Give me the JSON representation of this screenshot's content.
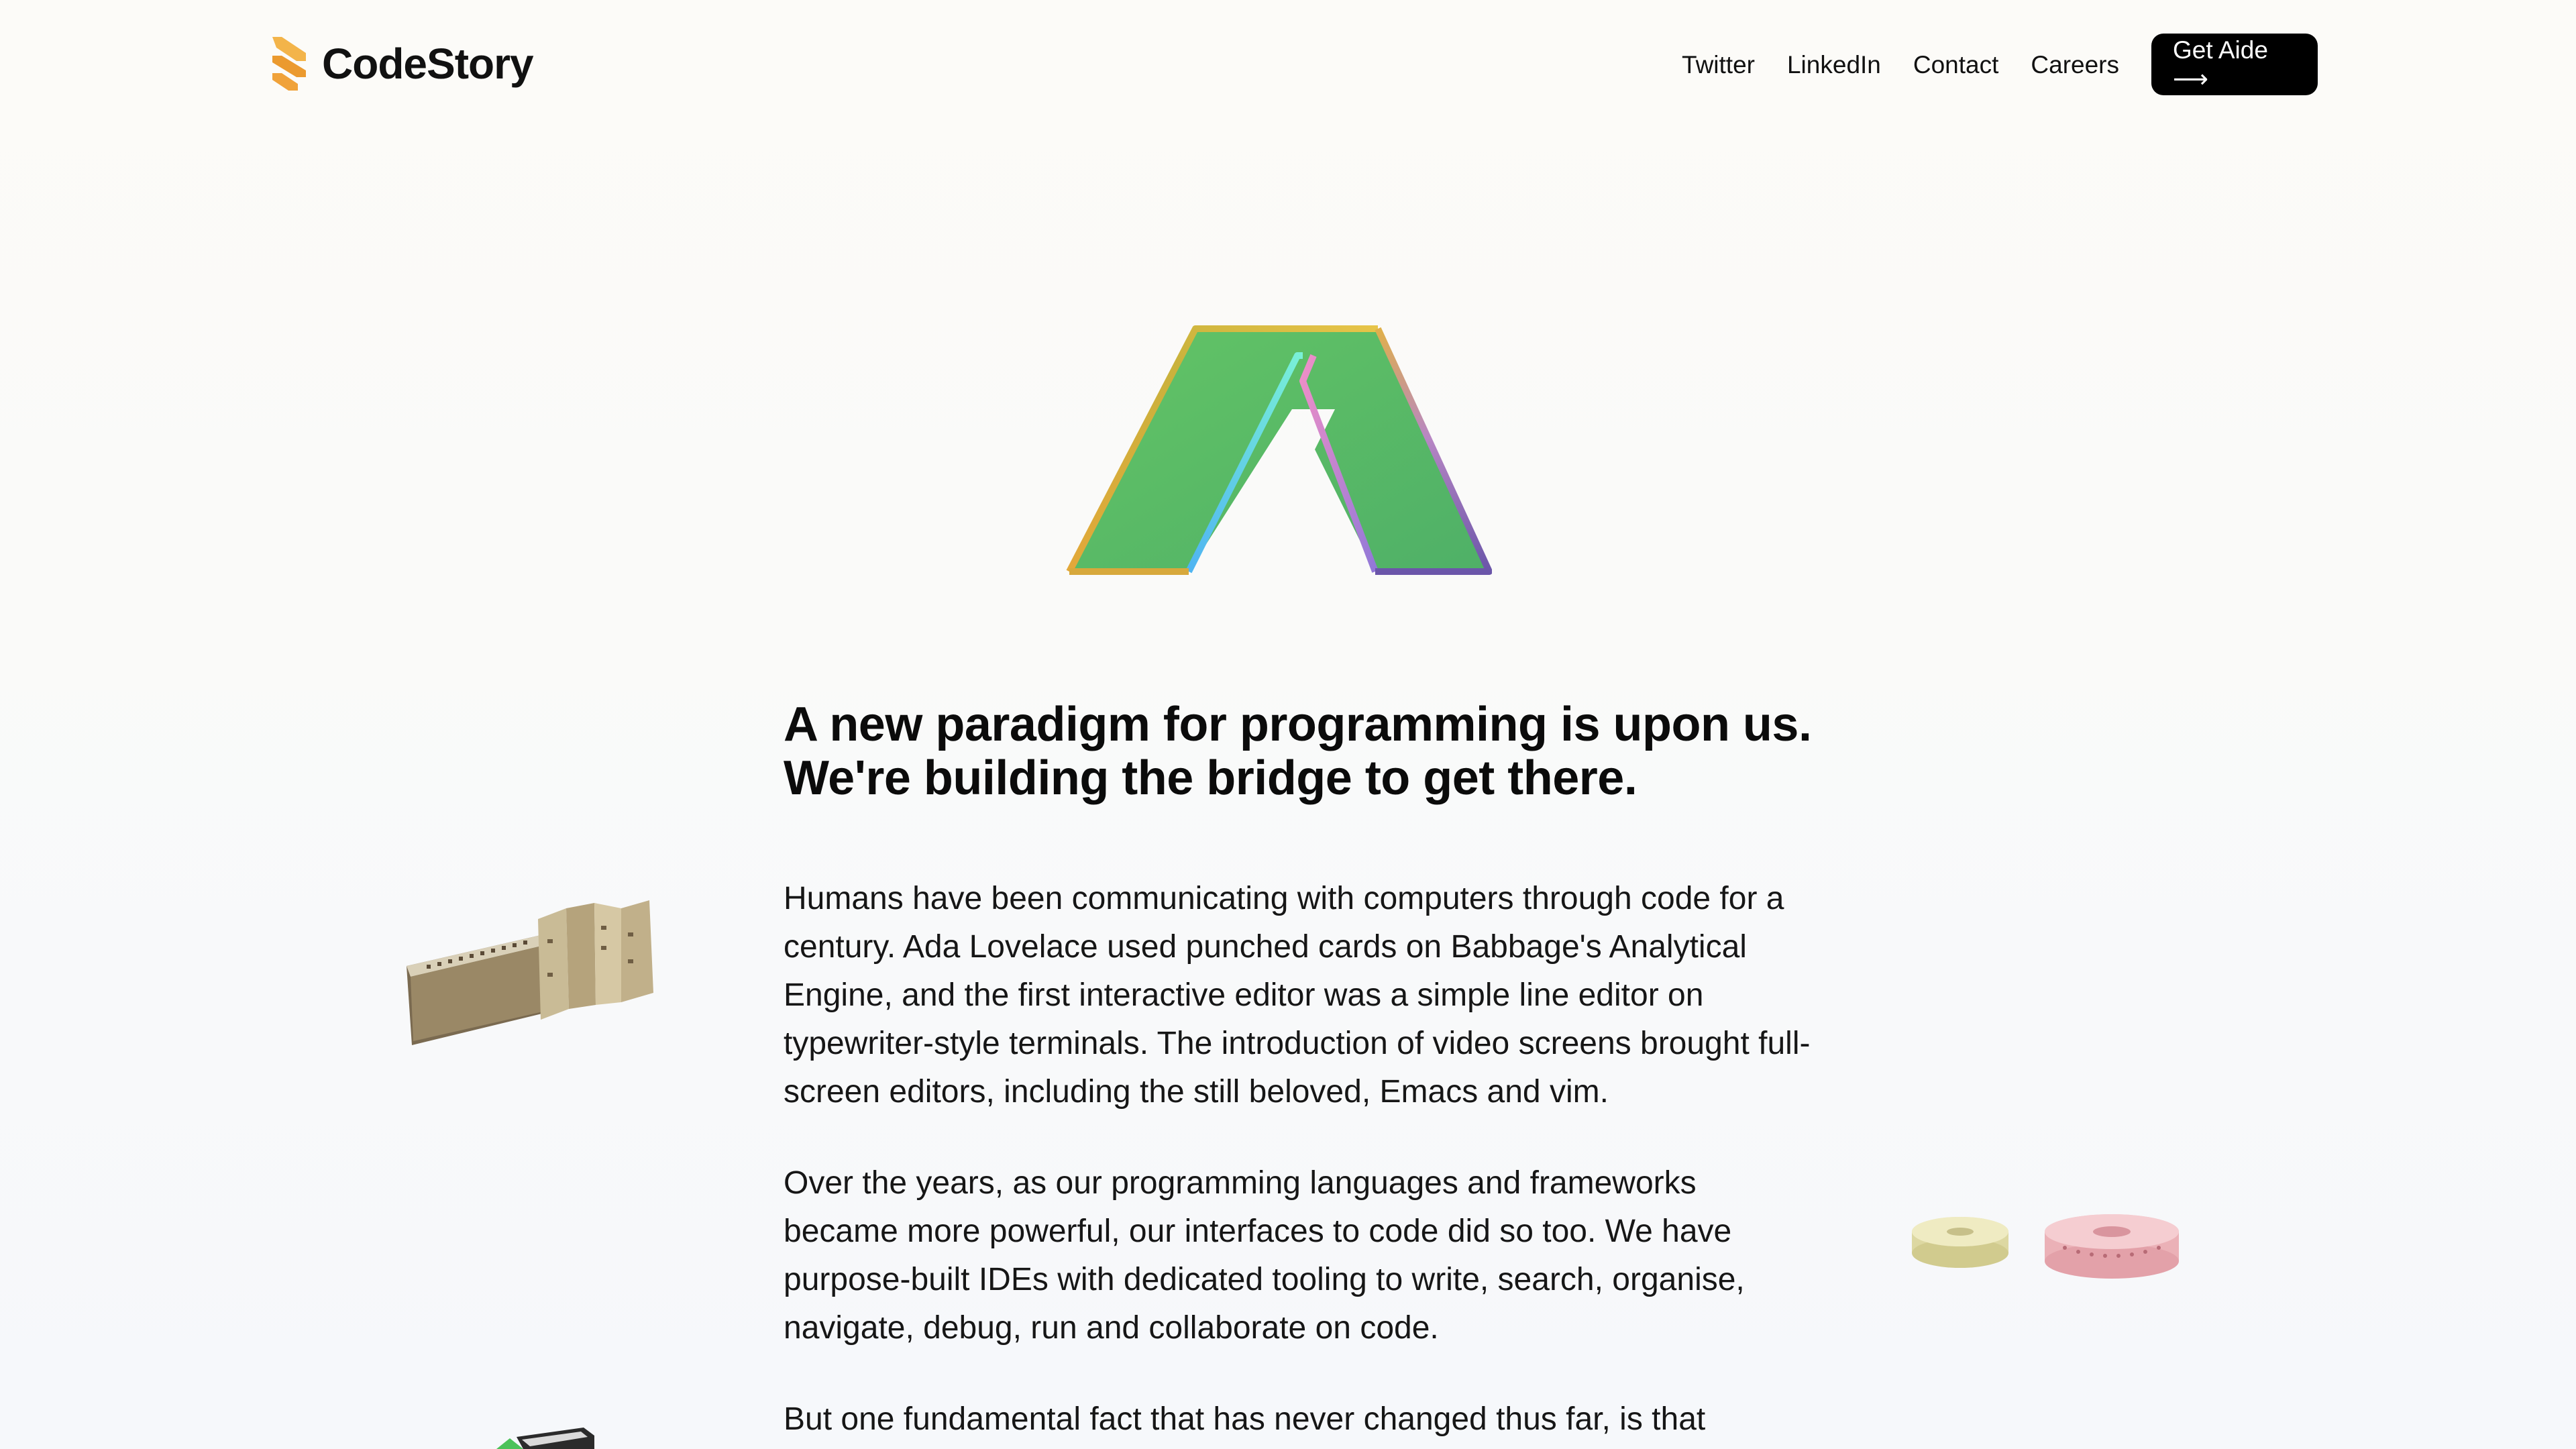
{
  "header": {
    "brand_name": "CodeStory",
    "nav": [
      {
        "label": "Twitter"
      },
      {
        "label": "LinkedIn"
      },
      {
        "label": "Contact"
      },
      {
        "label": "Careers"
      }
    ],
    "cta_label": "Get Aide ⟶"
  },
  "hero": {
    "headline_line1": "A new paradigm for programming is upon us.",
    "headline_line2": "We're building the bridge to get there."
  },
  "article": {
    "paragraphs": [
      "Humans have been communicating with computers through code for a century. Ada Lovelace used punched cards on Babbage's Analytical Engine, and the first interactive editor was a simple line editor on typewriter-style terminals. The introduction of video screens brought full-screen editors, including the still beloved, Emacs and vim.",
      "Over the years, as our programming languages and frameworks became more powerful, our interfaces to code did so too. We have purpose-built IDEs with dedicated tooling to write, search, organise, navigate, debug, run and collaborate on code.",
      "But one fundamental fact that has never changed thus far, is that"
    ]
  },
  "colors": {
    "brand_orange": "#f0a23a",
    "logo_green": "#5cbf64",
    "cta_background": "#000000"
  },
  "icons": {
    "brand": "codestory-logo-icon",
    "hero": "aide-logo-icon"
  }
}
